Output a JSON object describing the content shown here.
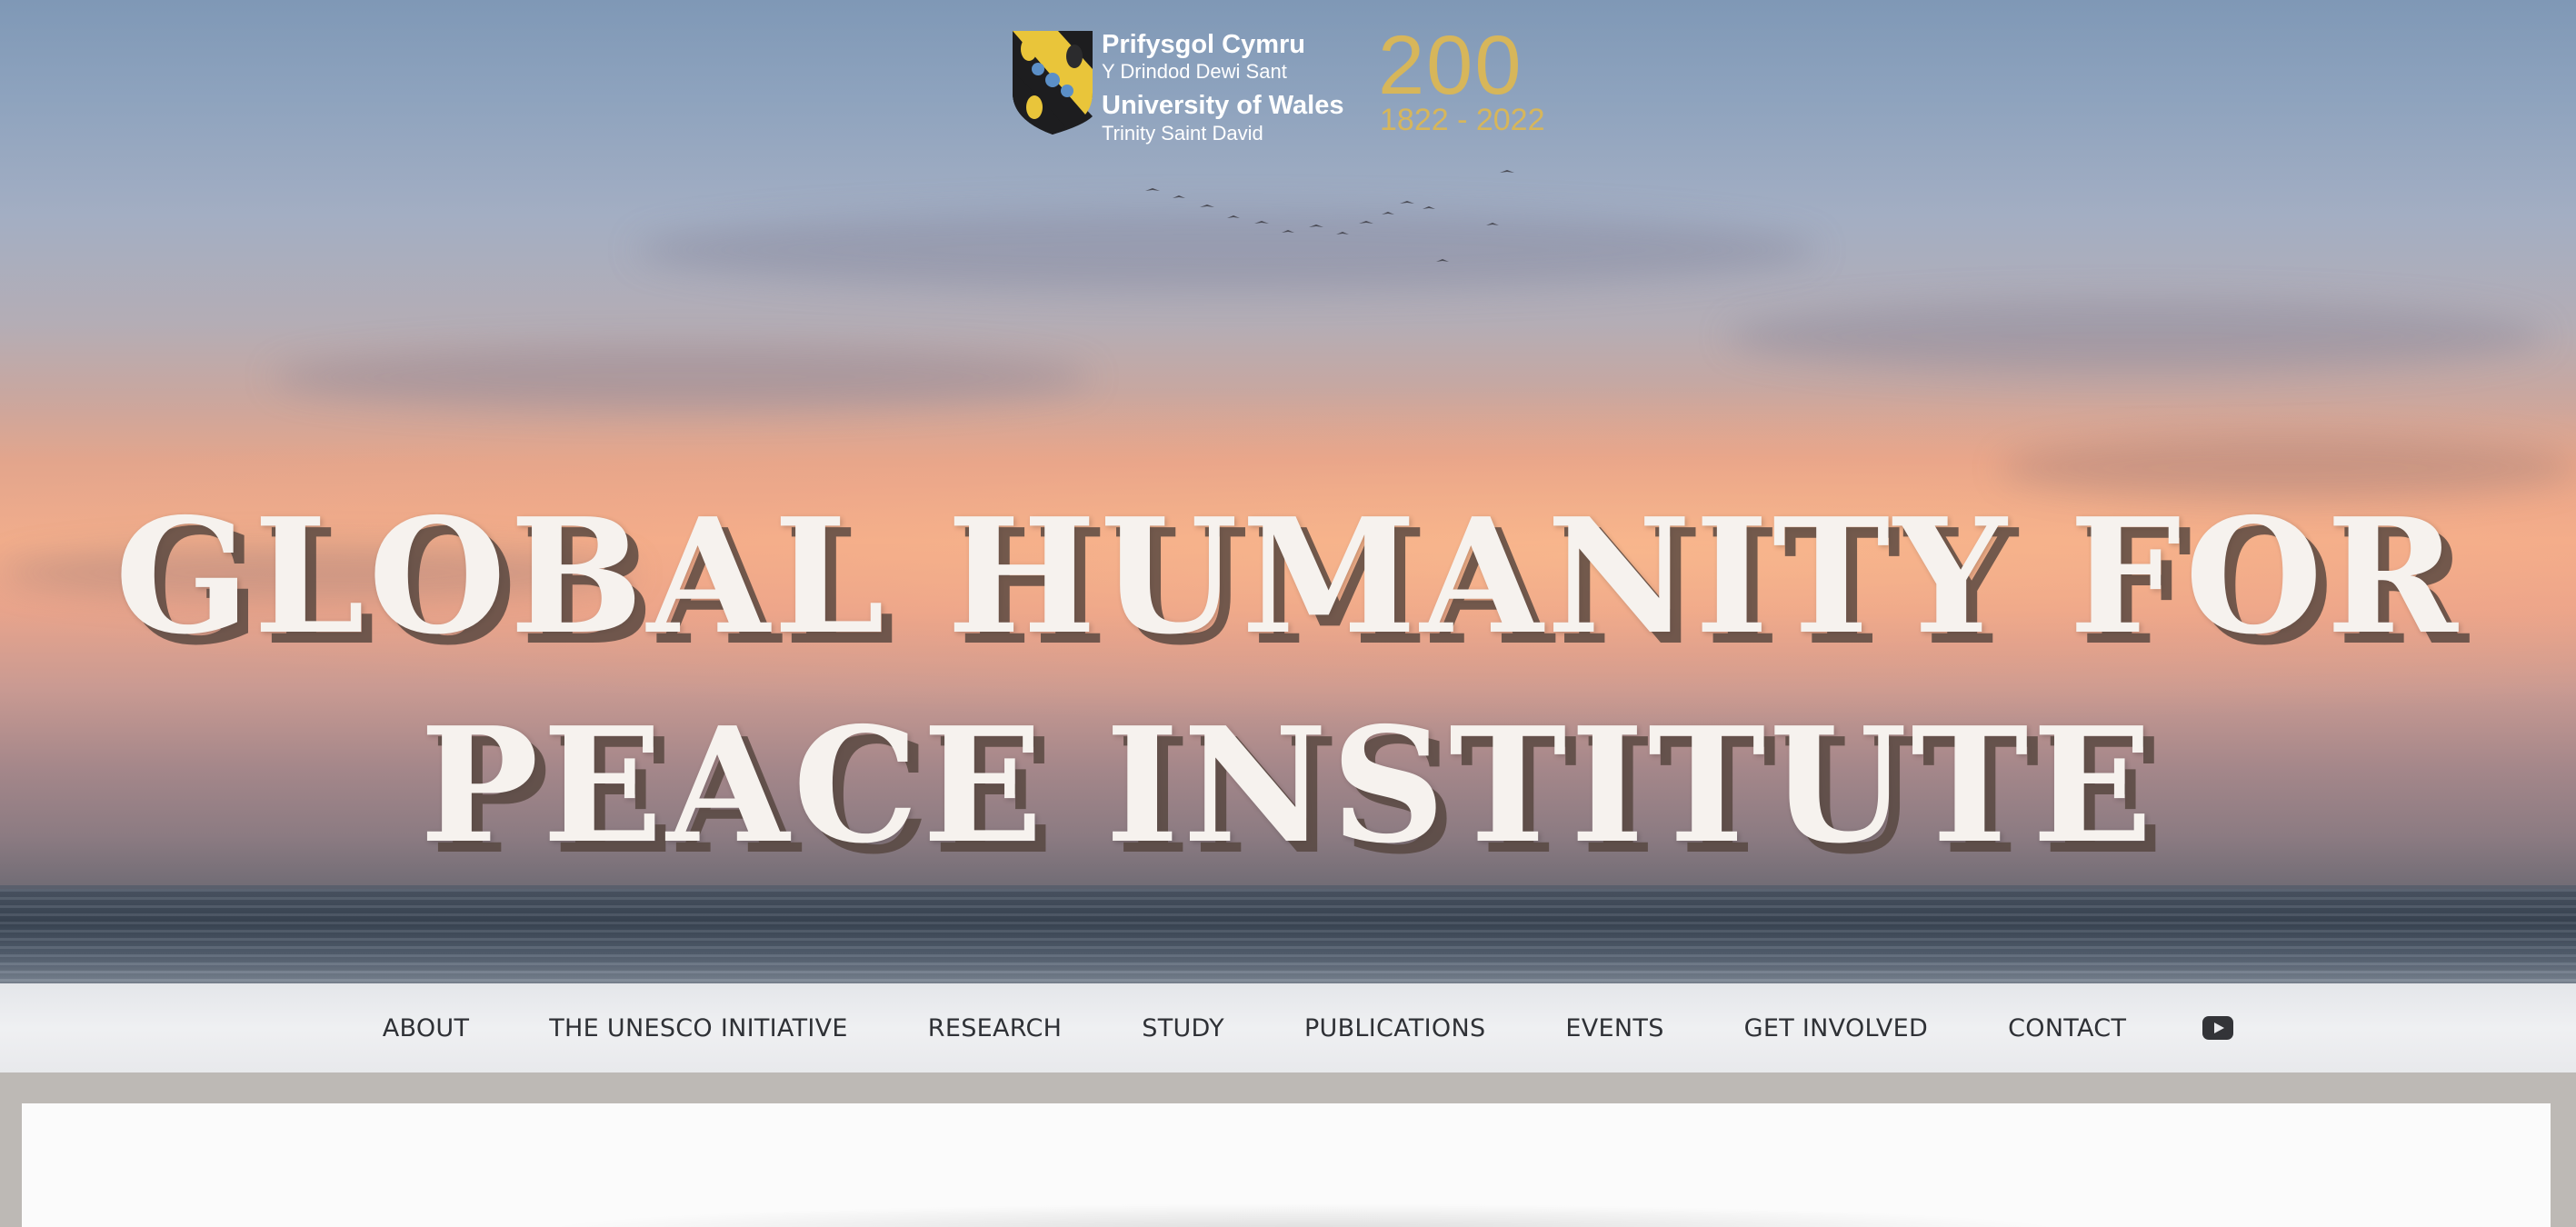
{
  "logo": {
    "welsh_name": "Prifysgol Cymru",
    "welsh_subname": "Y Drindod Dewi Sant",
    "english_name": "University of Wales",
    "english_subname": "Trinity Saint David",
    "bicentenary_mark": "200",
    "bicentenary_years": "1822 - 2022",
    "accent_color": "#d7b65a"
  },
  "hero": {
    "title_line1": "GLOBAL HUMANITY FOR",
    "title_line2": "PEACE INSTITUTE"
  },
  "nav": {
    "items": [
      {
        "label": "ABOUT"
      },
      {
        "label": "THE UNESCO INITIATIVE"
      },
      {
        "label": "RESEARCH"
      },
      {
        "label": "STUDY"
      },
      {
        "label": "PUBLICATIONS"
      },
      {
        "label": "EVENTS"
      },
      {
        "label": "GET INVOLVED"
      },
      {
        "label": "CONTACT"
      }
    ],
    "social_icon": "youtube-icon"
  }
}
